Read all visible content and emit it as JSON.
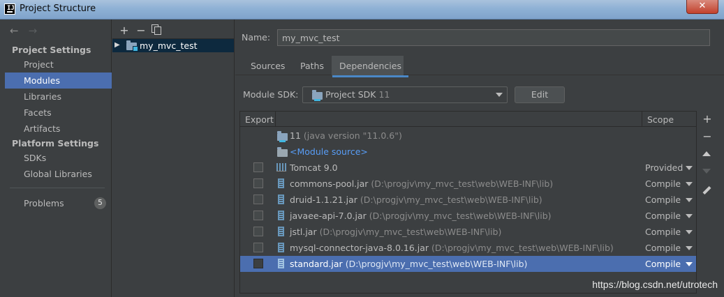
{
  "window": {
    "title": "Project Structure",
    "app_icon_letter": "IJ",
    "close_label": "✕"
  },
  "nav": {
    "back_icon": "←",
    "forward_icon": "→",
    "project_settings_header": "Project Settings",
    "project_items": [
      "Project",
      "Modules",
      "Libraries",
      "Facets",
      "Artifacts"
    ],
    "platform_settings_header": "Platform Settings",
    "platform_items": [
      "SDKs",
      "Global Libraries"
    ],
    "problems_label": "Problems",
    "problems_count": "5",
    "selected": "Modules"
  },
  "modules_tree": {
    "add_icon": "+",
    "remove_icon": "−",
    "items": [
      {
        "label": "my_mvc_test"
      }
    ]
  },
  "module": {
    "name_label": "Name:",
    "name_value": "my_mvc_test",
    "tabs": [
      "Sources",
      "Paths",
      "Dependencies"
    ],
    "active_tab": "Dependencies",
    "sdk_label": "Module SDK:",
    "sdk_value": "Project SDK",
    "sdk_version": "11",
    "edit_label": "Edit"
  },
  "dependencies": {
    "columns": {
      "export": "Export",
      "scope": "Scope"
    },
    "jdk_row": {
      "name": "11",
      "detail": "(java version \"11.0.6\")"
    },
    "module_source_row": {
      "name": "<Module source>"
    },
    "rows": [
      {
        "name": "Tomcat 9.0",
        "path": "",
        "scope": "Provided",
        "type": "lib"
      },
      {
        "name": "commons-pool.jar",
        "path": "(D:\\progjv\\my_mvc_test\\web\\WEB-INF\\lib)",
        "scope": "Compile",
        "type": "jar"
      },
      {
        "name": "druid-1.1.21.jar",
        "path": "(D:\\progjv\\my_mvc_test\\web\\WEB-INF\\lib)",
        "scope": "Compile",
        "type": "jar"
      },
      {
        "name": "javaee-api-7.0.jar",
        "path": "(D:\\progjv\\my_mvc_test\\web\\WEB-INF\\lib)",
        "scope": "Compile",
        "type": "jar"
      },
      {
        "name": "jstl.jar",
        "path": "(D:\\progjv\\my_mvc_test\\web\\WEB-INF\\lib)",
        "scope": "Compile",
        "type": "jar"
      },
      {
        "name": "mysql-connector-java-8.0.16.jar",
        "path": "(D:\\progjv\\my_mvc_test\\web\\WEB-INF\\lib)",
        "scope": "Compile",
        "type": "jar"
      },
      {
        "name": "standard.jar",
        "path": "(D:\\progjv\\my_mvc_test\\web\\WEB-INF\\lib)",
        "scope": "Compile",
        "type": "jar",
        "selected": true
      }
    ]
  },
  "side_toolbar": {
    "add_icon": "+",
    "remove_icon": "−"
  },
  "watermark": "https://blog.csdn.net/utrotech",
  "colors": {
    "selection": "#4b6eaf",
    "background": "#3c3f41",
    "link": "#589df6"
  }
}
